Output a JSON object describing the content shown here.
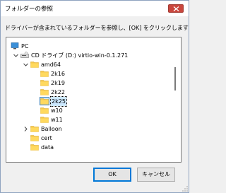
{
  "window": {
    "title": "フォルダーの参照"
  },
  "instruction": "ドライバーが含まれているフォルダーを参照し、[OK] をクリックします",
  "tree": [
    {
      "label": "PC",
      "icon": "pc-icon",
      "arrow": "",
      "level": 0
    },
    {
      "label": "CD ドライブ (D:) virtio-win-0.1.271",
      "icon": "cd-drive-icon",
      "arrow": "expanded",
      "level": 1
    },
    {
      "label": "amd64",
      "icon": "folder-icon",
      "arrow": "expanded",
      "level": 2
    },
    {
      "label": "2k16",
      "icon": "folder-icon",
      "arrow": "",
      "level": 3
    },
    {
      "label": "2k19",
      "icon": "folder-icon",
      "arrow": "",
      "level": 3
    },
    {
      "label": "2k22",
      "icon": "folder-icon",
      "arrow": "",
      "level": 3
    },
    {
      "label": "2k25",
      "icon": "folder-icon",
      "arrow": "",
      "level": 3,
      "selected": true
    },
    {
      "label": "w10",
      "icon": "folder-icon",
      "arrow": "",
      "level": 3
    },
    {
      "label": "w11",
      "icon": "folder-icon",
      "arrow": "",
      "level": 3
    },
    {
      "label": "Balloon",
      "icon": "folder-icon",
      "arrow": "collapsed",
      "level": 2
    },
    {
      "label": "cert",
      "icon": "folder-icon",
      "arrow": "",
      "level": 2
    },
    {
      "label": "data",
      "icon": "folder-icon",
      "arrow": "",
      "level": 2
    }
  ],
  "buttons": {
    "ok": "OK",
    "cancel": "キャンセル"
  },
  "colors": {
    "folder": "#f5c84c",
    "selection": "#cce8ff",
    "close": "#c9463d",
    "accent": "#0078d7"
  }
}
